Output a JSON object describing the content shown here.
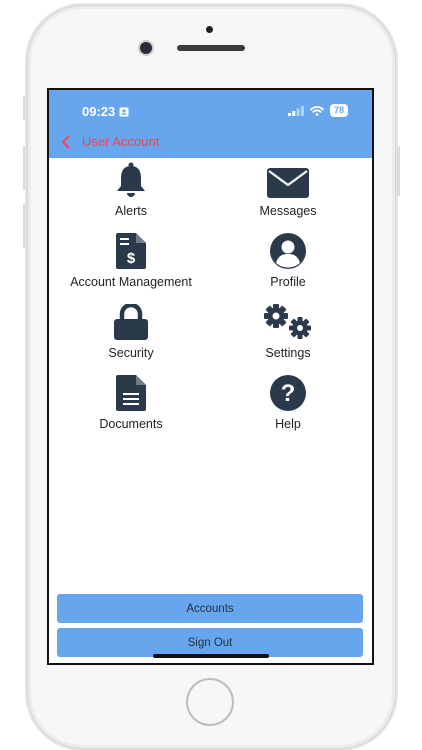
{
  "status_bar": {
    "time": "09:23",
    "battery": "78"
  },
  "nav": {
    "title": "User Account"
  },
  "tiles": [
    {
      "label": "Alerts",
      "icon": "bell-icon"
    },
    {
      "label": "Messages",
      "icon": "envelope-icon"
    },
    {
      "label": "Account Management",
      "icon": "invoice-dollar-icon"
    },
    {
      "label": "Profile",
      "icon": "user-circle-icon"
    },
    {
      "label": "Security",
      "icon": "lock-icon"
    },
    {
      "label": "Settings",
      "icon": "gears-icon"
    },
    {
      "label": "Documents",
      "icon": "document-icon"
    },
    {
      "label": "Help",
      "icon": "question-circle-icon"
    }
  ],
  "buttons": {
    "accounts": "Accounts",
    "sign_out": "Sign Out"
  },
  "colors": {
    "header": "#67a6ec",
    "icon": "#2b3a4a",
    "back_title": "#e8465b"
  }
}
